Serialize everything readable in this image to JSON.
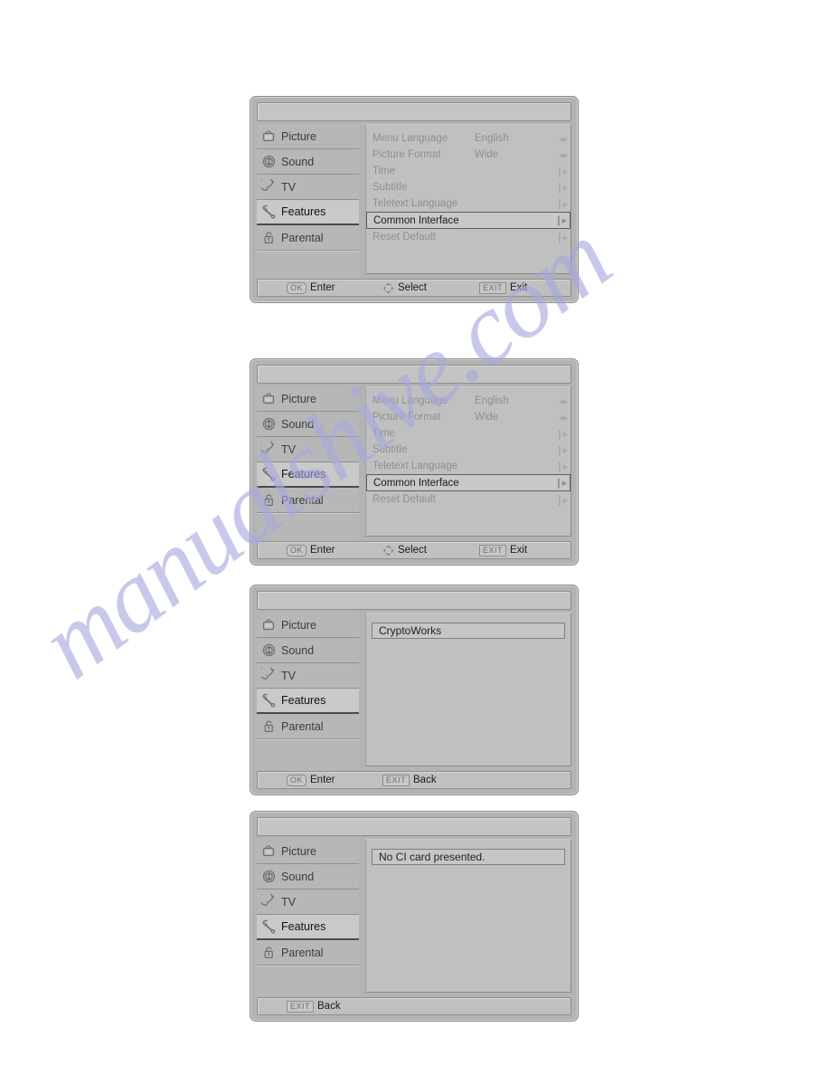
{
  "watermark": {
    "text": "manualshive.com",
    "color": "#a6a8de"
  },
  "sidebar": {
    "items": [
      {
        "label": "Picture",
        "icon": "tv-picture-icon"
      },
      {
        "label": "Sound",
        "icon": "speaker-sound-icon"
      },
      {
        "label": "TV",
        "icon": "satellite-tv-icon"
      },
      {
        "label": "Features",
        "icon": "wrench-features-icon"
      },
      {
        "label": "Parental",
        "icon": "padlock-parental-icon"
      }
    ],
    "selected": "Features"
  },
  "panels": [
    {
      "id": "panel-features-menu-1",
      "type": "menu",
      "rows": [
        {
          "label": "Menu Language",
          "value": "English",
          "arrow": "leftright",
          "active": false
        },
        {
          "label": "Picture Format",
          "value": "Wide",
          "arrow": "leftright",
          "active": false
        },
        {
          "label": "Time",
          "value": "",
          "arrow": "right",
          "active": false
        },
        {
          "label": "Subtitle",
          "value": "",
          "arrow": "right",
          "active": false
        },
        {
          "label": "Teletext Language",
          "value": "",
          "arrow": "right",
          "active": false
        },
        {
          "label": "Common Interface",
          "value": "",
          "arrow": "right",
          "active": true
        },
        {
          "label": "Reset Default",
          "value": "",
          "arrow": "right",
          "active": false
        }
      ],
      "hints": [
        {
          "key": "OK",
          "shape": "round",
          "label": "Enter"
        },
        {
          "key": "",
          "shape": "navpad",
          "label": "Select"
        },
        {
          "key": "EXIT",
          "shape": "square",
          "label": "Exit"
        }
      ]
    },
    {
      "id": "panel-features-menu-2",
      "type": "menu",
      "rows": [
        {
          "label": "Menu Language",
          "value": "English",
          "arrow": "leftright",
          "active": false
        },
        {
          "label": "Picture Format",
          "value": "Wide",
          "arrow": "leftright",
          "active": false
        },
        {
          "label": "Time",
          "value": "",
          "arrow": "right",
          "active": false
        },
        {
          "label": "Subtitle",
          "value": "",
          "arrow": "right",
          "active": false
        },
        {
          "label": "Teletext Language",
          "value": "",
          "arrow": "right",
          "active": false
        },
        {
          "label": "Common Interface",
          "value": "",
          "arrow": "right",
          "active": true
        },
        {
          "label": "Reset Default",
          "value": "",
          "arrow": "right",
          "active": false
        }
      ],
      "hints": [
        {
          "key": "OK",
          "shape": "round",
          "label": "Enter"
        },
        {
          "key": "",
          "shape": "navpad",
          "label": "Select"
        },
        {
          "key": "EXIT",
          "shape": "square",
          "label": "Exit"
        }
      ]
    },
    {
      "id": "panel-common-interface-list",
      "type": "list",
      "rows": [
        {
          "label": "CryptoWorks"
        }
      ],
      "hints": [
        {
          "key": "OK",
          "shape": "round",
          "label": "Enter"
        },
        {
          "key": "EXIT",
          "shape": "square",
          "label": "Back"
        }
      ]
    },
    {
      "id": "panel-no-ci-card",
      "type": "list",
      "rows": [
        {
          "label": "No CI card presented."
        }
      ],
      "hints": [
        {
          "key": "EXIT",
          "shape": "square",
          "label": "Back"
        }
      ]
    }
  ]
}
